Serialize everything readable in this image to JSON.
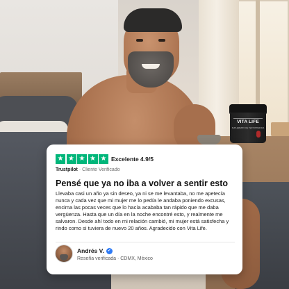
{
  "product": {
    "brand": "VITA LIFE",
    "subtitle": "SUPLEMENTO DE TESTOSTERONA"
  },
  "review": {
    "stars": 5,
    "star_color": "#00b67a",
    "rating_label": "Excelente 4.9/5",
    "source": "Trustpilot",
    "separator": "·",
    "source_note": "Cliente Verificado",
    "headline": "Pensé que ya no iba a volver a sentir esto",
    "body": "Llevaba casi un año ya sin deseo, ya ni se me levantaba, no me apetecía nunca y cada vez que mi mujer me lo pedía le andaba poniendo excusas, encima las pocas veces que lo hacía acababa tan rápido que me daba vergüenza. Hasta que un día en la noche encontré esto, y realmente me salvaron. Desde ahí todo en mi relación cambió, mi mujer está satisfecha y rindo como si tuviera de nuevo 20 años. Agradecido con Vita Life.",
    "author": "Andrés V.",
    "author_meta": "Reseña verificada · CDMX, México",
    "verified_icon": "verified-check-icon",
    "verified_color": "#2f7bf5"
  }
}
